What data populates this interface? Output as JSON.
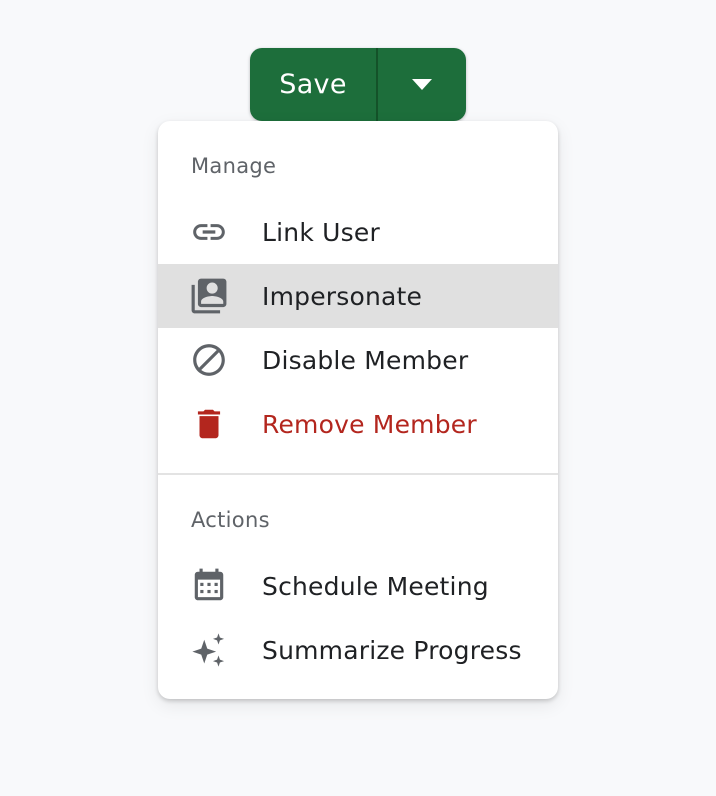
{
  "split_button": {
    "save_label": "Save",
    "toggle_icon": "caret-down-icon",
    "color": "#1d6e3b"
  },
  "menu": {
    "sections": [
      {
        "header": "Manage",
        "items": [
          {
            "label": "Link User",
            "icon": "link-icon"
          },
          {
            "label": "Impersonate",
            "icon": "impersonate-icon",
            "highlighted": true
          },
          {
            "label": "Disable Member",
            "icon": "block-icon"
          },
          {
            "label": "Remove Member",
            "icon": "trash-icon",
            "danger": true,
            "color": "#b3261e"
          }
        ]
      },
      {
        "header": "Actions",
        "items": [
          {
            "label": "Schedule Meeting",
            "icon": "calendar-icon"
          },
          {
            "label": "Summarize Progress",
            "icon": "sparkle-icon"
          }
        ]
      }
    ]
  }
}
